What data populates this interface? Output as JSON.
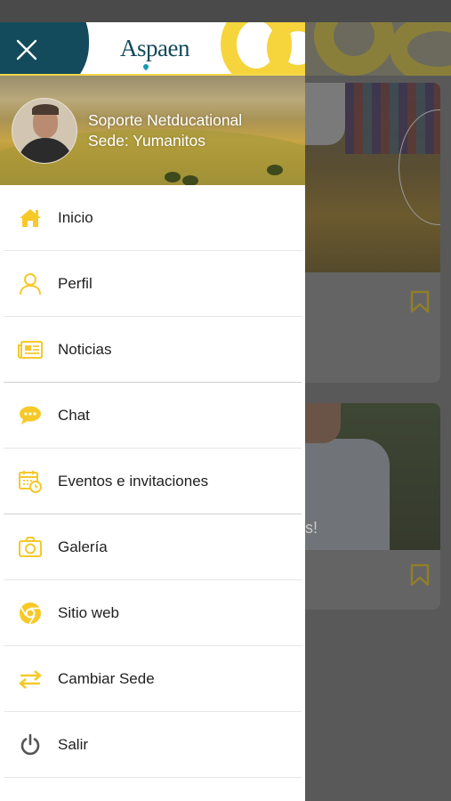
{
  "app": {
    "logo_text": "Aspaen",
    "accent_color": "#f6d43c",
    "brand_color": "#134a5c"
  },
  "profile": {
    "name": "Soporte Netducational",
    "campus": "Sede: Yumanitos"
  },
  "menu": {
    "items": [
      {
        "label": "Inicio",
        "icon": "home-icon"
      },
      {
        "label": "Perfil",
        "icon": "user-icon"
      },
      {
        "label": "Noticias",
        "icon": "newspaper-icon"
      },
      {
        "label": "Chat",
        "icon": "chat-bubble-icon"
      },
      {
        "label": "Eventos e invitaciones",
        "icon": "calendar-clock-icon"
      },
      {
        "label": "Galería",
        "icon": "camera-icon"
      },
      {
        "label": "Sitio web",
        "icon": "chrome-icon"
      },
      {
        "label": "Cambiar Sede",
        "icon": "swap-arrows-icon"
      },
      {
        "label": "Salir",
        "icon": "power-icon"
      }
    ]
  },
  "background": {
    "card2_overlay_text": "s!"
  }
}
